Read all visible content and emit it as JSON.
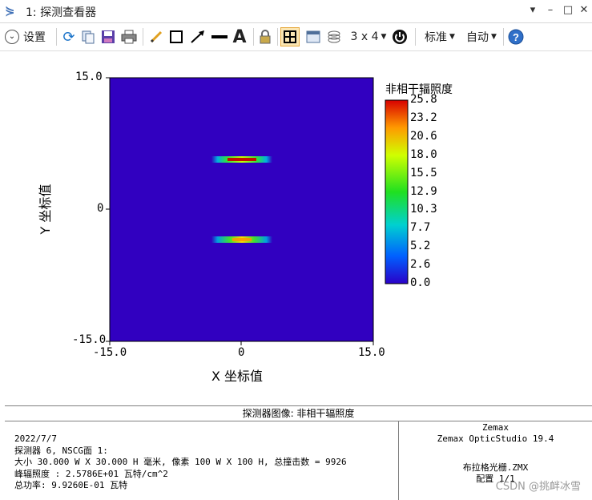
{
  "window": {
    "title": "1: 探测查看器",
    "controls": [
      "▾",
      "–",
      "□",
      "✕"
    ]
  },
  "toolbar": {
    "settings_label": "设置",
    "layout_label": "3 x 4",
    "standard_label": "标准",
    "auto_label": "自动",
    "text_tool_label": "A"
  },
  "plot": {
    "ylabel": "Y 坐标值",
    "xlabel": "X 坐标值",
    "x_ticks": [
      "-15.0",
      "0",
      "15.0"
    ],
    "y_ticks": [
      "15.0",
      "0",
      "-15.0"
    ],
    "colorbar_title": "非相干辐照度",
    "colorbar_ticks": [
      "25.8",
      "23.2",
      "20.6",
      "18.0",
      "15.5",
      "12.9",
      "10.3",
      "7.7",
      "5.2",
      "2.6",
      "0.0"
    ],
    "background_color": "#3100c0"
  },
  "chart_data": {
    "type": "heatmap",
    "title": "",
    "xlabel": "X 坐标值",
    "ylabel": "Y 坐标值",
    "xlim": [
      -15.0,
      15.0
    ],
    "ylim": [
      -15.0,
      15.0
    ],
    "zlim": [
      0.0,
      25.8
    ],
    "colorbar_label": "非相干辐照度",
    "features": [
      {
        "name": "upper-line",
        "y": 5.5,
        "x_range": [
          -3.3,
          3.3
        ],
        "peak": 25.8
      },
      {
        "name": "lower-line",
        "y": -3.5,
        "x_range": [
          -3.3,
          3.3
        ],
        "peak": 20.0
      }
    ]
  },
  "footer": {
    "caption": "探测器图像: 非相干辐照度",
    "date": "2022/7/7",
    "detector": "探测器 6, NSCG面 1:",
    "size": "大小 30.000 W X 30.000 H 毫米, 像素 100 W X 100 H, 总撞击数 = 9926",
    "peak": "峰辐照度 : 2.5786E+01 瓦特/cm^2",
    "total_power": "总功率: 9.9260E-01 瓦特",
    "company": "Zemax",
    "product": "Zemax OpticStudio 19.4",
    "file": "布拉格光栅.ZMX",
    "config": "配置 1/1"
  },
  "watermark": "CSDN @挑衅冰雪"
}
